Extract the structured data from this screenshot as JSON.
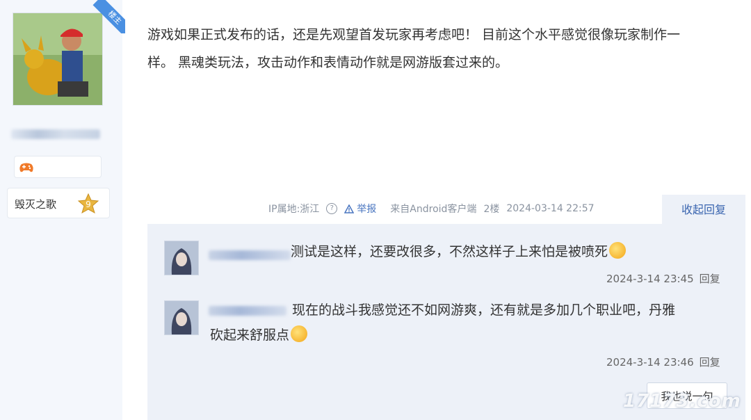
{
  "author": {
    "badge": "楼主",
    "level_name": "毁灭之歌",
    "level_number": "9"
  },
  "post": {
    "line1": "游戏如果正式发布的话，还是先观望首发玩家再考虑吧！ 目前这个水平感觉很像玩家制作一",
    "line2": "样。 黑魂类玩法，攻击动作和表情动作就是网游版套过来的。",
    "ip": "IP属地:浙江",
    "report": "举报",
    "source": "来自Android客户端",
    "floor": "2楼",
    "timestamp": "2024-03-14 22:57",
    "collapse_label": "收起回复"
  },
  "replies": [
    {
      "text": "测试是这样，还要改很多，不然这样子上来怕是被喷死",
      "time": "2024-3-14 23:45",
      "reply_label": "回复"
    },
    {
      "text_line1": "现在的战斗我感觉还不如网游爽，还有就是多加几个职业吧，丹雅",
      "text_line2": "砍起来舒服点",
      "time": "2024-3-14 23:46",
      "reply_label": "回复"
    }
  ],
  "say_button": "我也说一句",
  "watermark": "17173.com",
  "colors": {
    "accent": "#4a90e2",
    "link": "#3b66b0",
    "reply_bg": "#edf1f8",
    "sidebar_bg": "#f4f7fc"
  }
}
